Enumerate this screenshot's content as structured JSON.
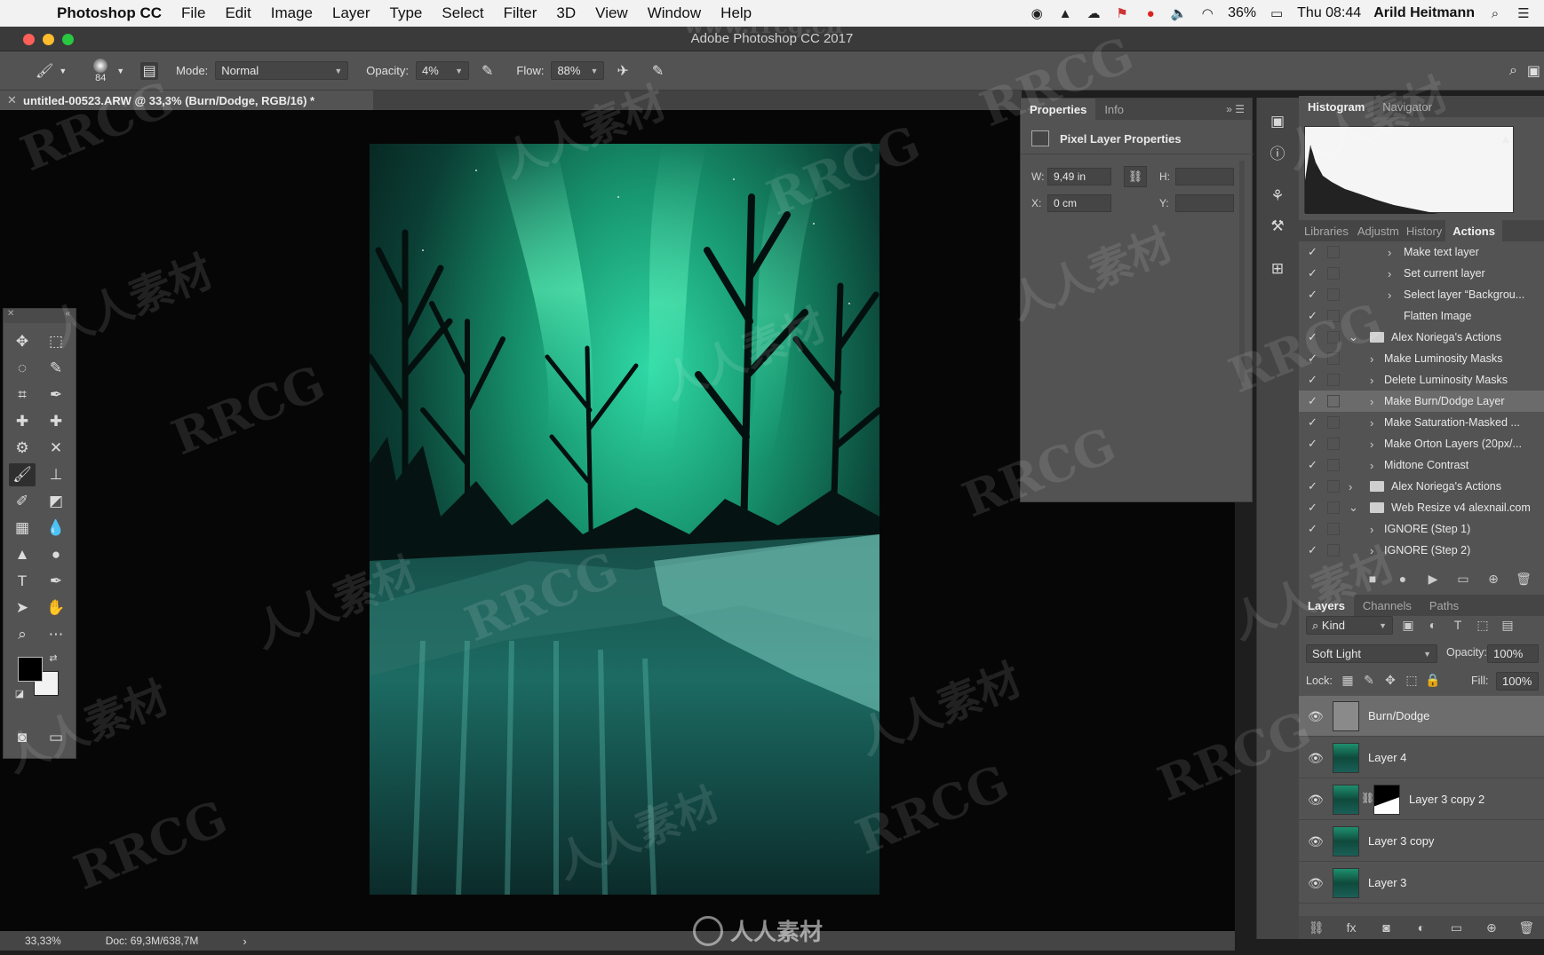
{
  "menubar": {
    "app_name": "Photoshop CC",
    "items": [
      "File",
      "Edit",
      "Image",
      "Layer",
      "Type",
      "Select",
      "Filter",
      "3D",
      "View",
      "Window",
      "Help"
    ],
    "battery": "36%",
    "clock": "Thu 08:44",
    "user": "Arild Heitmann"
  },
  "window": {
    "title": "Adobe Photoshop CC 2017"
  },
  "options": {
    "brush_size": "84",
    "mode_label": "Mode:",
    "mode_value": "Normal",
    "opacity_label": "Opacity:",
    "opacity_value": "4%",
    "flow_label": "Flow:",
    "flow_value": "88%"
  },
  "document": {
    "tab_title": "untitled-00523.ARW @ 33,3% (Burn/Dodge, RGB/16) *"
  },
  "status": {
    "zoom": "33,33%",
    "doc_size": "Doc: 69,3M/638,7M"
  },
  "properties": {
    "tabs": [
      "Properties",
      "Info"
    ],
    "heading": "Pixel Layer Properties",
    "w_label": "W:",
    "w_value": "9,49 in",
    "h_label": "H:",
    "x_label": "X:",
    "x_value": "0 cm",
    "y_label": "Y:"
  },
  "histogram": {
    "tabs": [
      "Histogram",
      "Navigator"
    ]
  },
  "actions_panel": {
    "tabs": [
      "Libraries",
      "Adjustm",
      "History",
      "Actions"
    ],
    "rows": [
      {
        "label": "Make text layer",
        "type": "step",
        "indent": 2
      },
      {
        "label": "Set current layer",
        "type": "step",
        "indent": 2
      },
      {
        "label": "Select layer “Backgrou...",
        "type": "step",
        "indent": 2
      },
      {
        "label": "Flatten Image",
        "type": "step-noarrow",
        "indent": 2
      },
      {
        "label": "Alex Noriega's Actions",
        "type": "set-open",
        "indent": 0
      },
      {
        "label": "Make Luminosity Masks",
        "type": "action",
        "indent": 1
      },
      {
        "label": "Delete Luminosity Masks",
        "type": "action",
        "indent": 1
      },
      {
        "label": "Make Burn/Dodge Layer",
        "type": "action",
        "indent": 1,
        "selected": true
      },
      {
        "label": "Make Saturation-Masked ...",
        "type": "action",
        "indent": 1
      },
      {
        "label": "Make Orton Layers (20px/...",
        "type": "action",
        "indent": 1
      },
      {
        "label": "Midtone Contrast",
        "type": "action",
        "indent": 1
      },
      {
        "label": "Alex Noriega's Actions",
        "type": "set-closed",
        "indent": 0
      },
      {
        "label": "Web Resize v4 alexnail.com",
        "type": "set-open",
        "indent": 0
      },
      {
        "label": "IGNORE (Step 1)",
        "type": "action",
        "indent": 1
      },
      {
        "label": "IGNORE (Step 2)",
        "type": "action",
        "indent": 1
      }
    ]
  },
  "layers_panel": {
    "tabs": [
      "Layers",
      "Channels",
      "Paths"
    ],
    "filter_kind": "Kind",
    "blend_mode": "Soft Light",
    "opacity_label": "Opacity:",
    "opacity_value": "100%",
    "lock_label": "Lock:",
    "fill_label": "Fill:",
    "fill_value": "100%",
    "layers": [
      {
        "name": "Burn/Dodge",
        "thumb": "gray",
        "selected": true
      },
      {
        "name": "Layer 4",
        "thumb": "photo"
      },
      {
        "name": "Layer 3 copy 2",
        "thumb": "photo-mask"
      },
      {
        "name": "Layer 3 copy",
        "thumb": "photo"
      },
      {
        "name": "Layer 3",
        "thumb": "photo"
      }
    ]
  },
  "watermark": {
    "text_a": "RRCG",
    "text_b": "人人素材",
    "bottom_logo": "人人素材",
    "url": "www.rrcg.cn"
  },
  "colors": {
    "accent_bg": "#535353",
    "canvas": "#060606",
    "aurora": "#1fbf8f"
  }
}
